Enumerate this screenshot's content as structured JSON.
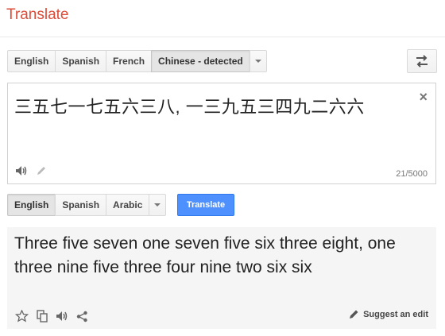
{
  "app": {
    "title": "Translate"
  },
  "source_languages": {
    "buttons": [
      "English",
      "Spanish",
      "French",
      "Chinese - detected"
    ],
    "active_index": 3
  },
  "target_languages": {
    "buttons": [
      "English",
      "Spanish",
      "Arabic"
    ],
    "active_index": 0
  },
  "source": {
    "text": "三五七一七五六三八, 一三九五三四九二六六",
    "char_count": "21/5000",
    "close_symbol": "×"
  },
  "actions": {
    "translate_label": "Translate"
  },
  "output": {
    "text": "Three five seven one seven five six three eight, one three nine five three four nine two six six",
    "suggest_label": "Suggest an edit"
  },
  "colors": {
    "title": "#dd4b39",
    "translate_button": "#4d90fe",
    "output_bg": "#f5f5f5"
  },
  "icons": {
    "source_tools": [
      "speaker-icon",
      "pencil-icon"
    ],
    "output_tools": [
      "star-icon",
      "copy-icon",
      "speaker-icon",
      "share-icon"
    ],
    "swap": "swap-icon",
    "dropdowns": "chevron-down-icon"
  }
}
